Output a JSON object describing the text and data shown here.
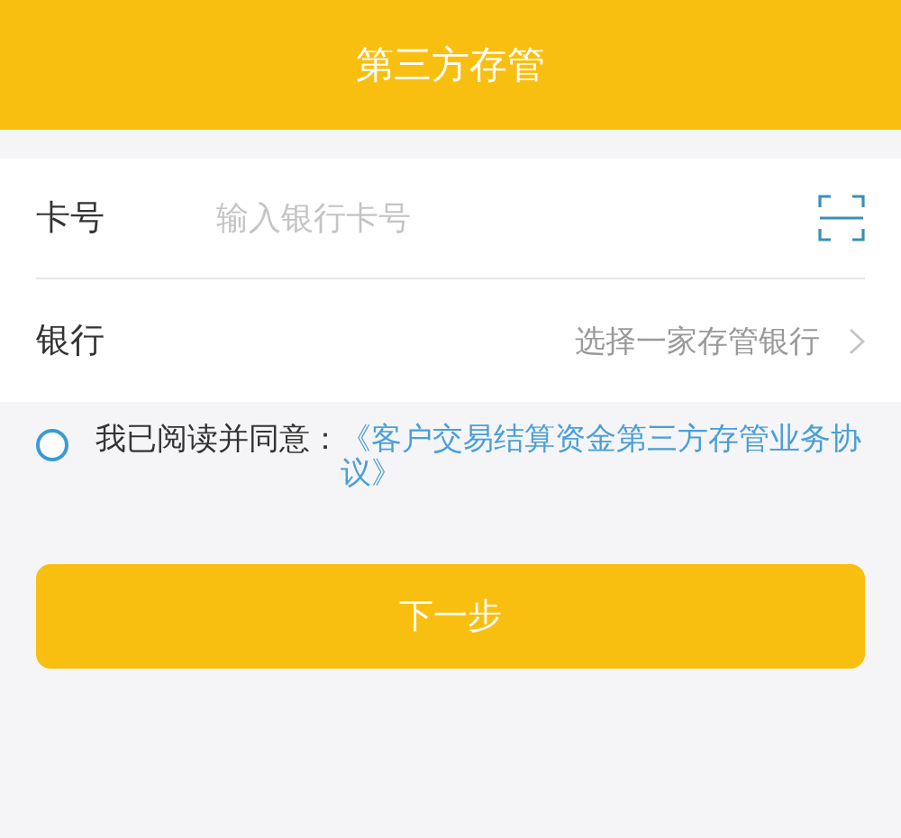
{
  "header": {
    "title": "第三方存管"
  },
  "form": {
    "card_number": {
      "label": "卡号",
      "placeholder": "输入银行卡号"
    },
    "bank": {
      "label": "银行",
      "value": "选择一家存管银行"
    }
  },
  "agreement": {
    "checked": false,
    "text": "我已阅读并同意：",
    "link": "《客户交易结算资金第三方存管业务协议》"
  },
  "next_button": "下一步"
}
